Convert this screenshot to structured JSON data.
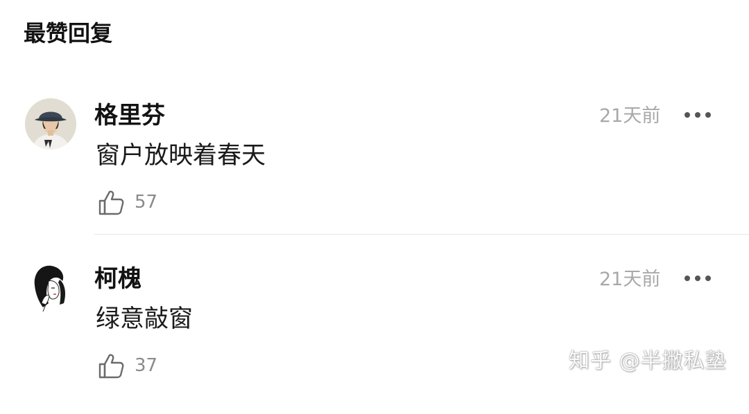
{
  "section": {
    "title": "最赞回复"
  },
  "comments": [
    {
      "author": "格里芬",
      "time": "21天前",
      "content": "窗户放映着春天",
      "likes": "57",
      "avatar_icon": "avatar-bucket-hat-person-icon"
    },
    {
      "author": "柯槐",
      "time": "21天前",
      "content": "绿意敲窗",
      "likes": "37",
      "avatar_icon": "avatar-sketch-girl-icon"
    }
  ],
  "icons": {
    "more": "more-horizontal-icon",
    "like": "thumbs-up-icon"
  },
  "colors": {
    "text_primary": "#121212",
    "text_secondary": "#a8a8a8",
    "like_count": "#8a8a8a",
    "divider": "#e6e6e6"
  },
  "watermark": {
    "text": "知乎 @半撇私塾"
  }
}
